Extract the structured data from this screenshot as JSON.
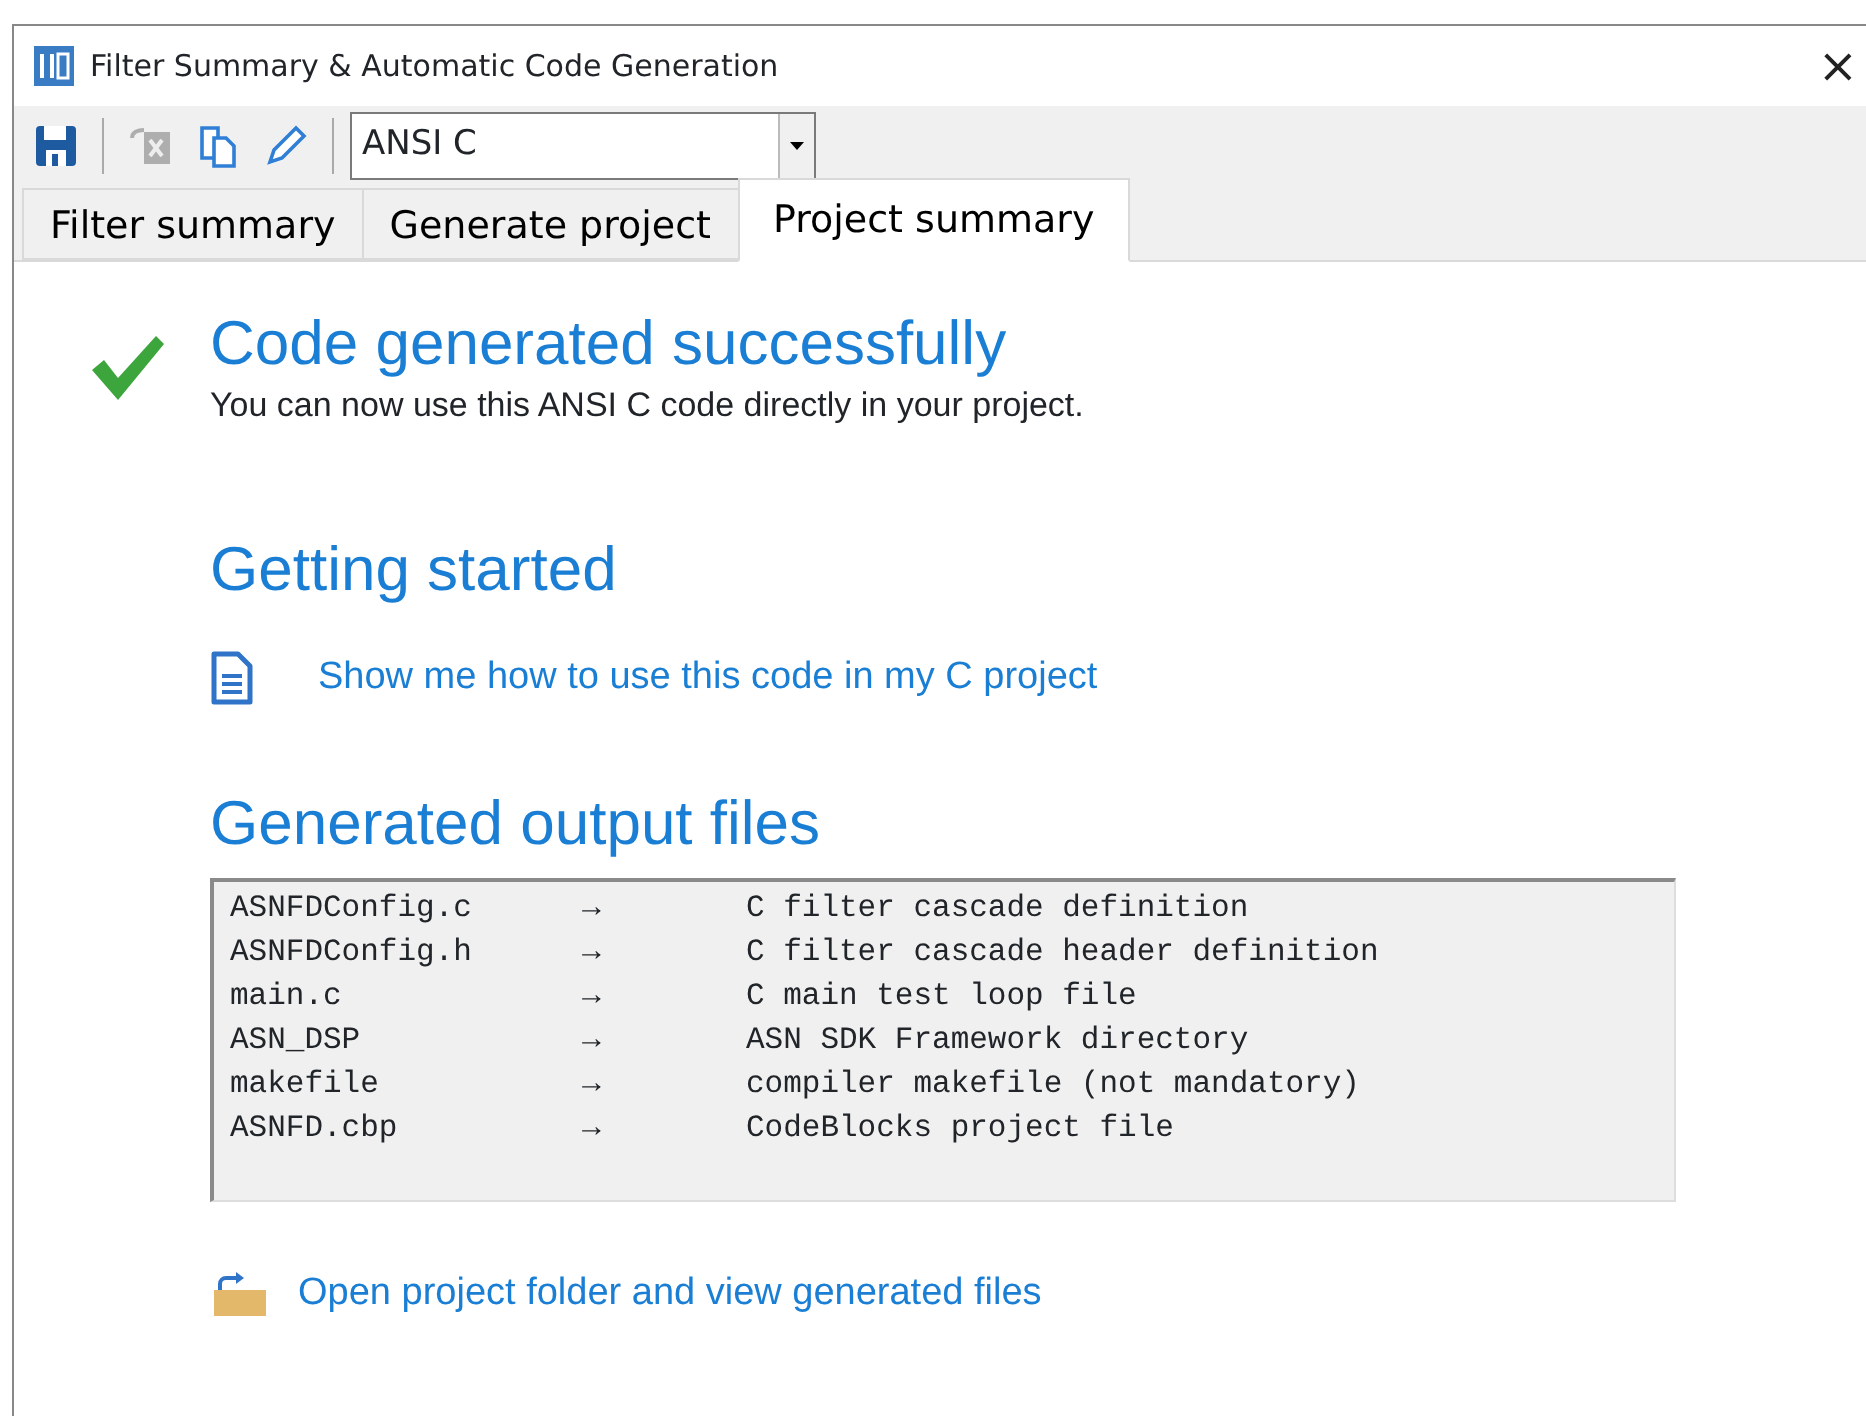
{
  "window": {
    "title": "Filter Summary & Automatic Code Generation",
    "close": "×"
  },
  "toolbar": {
    "buttons": [
      {
        "kind": "save",
        "disabled": false
      },
      {
        "kind": "export",
        "disabled": true
      },
      {
        "kind": "copy",
        "disabled": false
      },
      {
        "kind": "edit",
        "disabled": false
      }
    ],
    "language": {
      "value": "ANSI C"
    }
  },
  "tabs": [
    {
      "label": "Filter summary",
      "selected": false
    },
    {
      "label": "Generate project",
      "selected": false
    },
    {
      "label": "Project summary",
      "selected": true
    }
  ],
  "status": {
    "title": "Code generated successfully",
    "message": "You can now use this ANSI C code directly in your project."
  },
  "getting_started": {
    "heading": "Getting started",
    "link": "Show me how to use this code in my C project"
  },
  "output_files": {
    "heading": "Generated output files",
    "rows": [
      {
        "file": "ASNFDConfig.c",
        "arrow": "→",
        "description": "C filter cascade definition"
      },
      {
        "file": "ASNFDConfig.h",
        "arrow": "→",
        "description": "C filter cascade header definition"
      },
      {
        "file": "main.c",
        "arrow": "→",
        "description": "C main test loop file"
      },
      {
        "file": "ASN_DSP",
        "arrow": "→",
        "description": "ASN SDK Framework directory"
      },
      {
        "file": "makefile",
        "arrow": "→",
        "description": "compiler makefile (not mandatory)"
      },
      {
        "file": "ASNFD.cbp",
        "arrow": "→",
        "description": "CodeBlocks project file"
      }
    ],
    "link": "Open project folder and view generated files"
  }
}
